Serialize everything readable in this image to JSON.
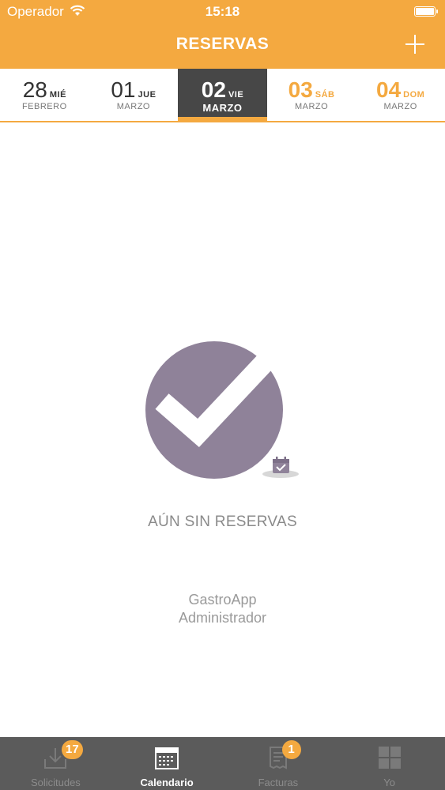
{
  "status_bar": {
    "carrier": "Operador",
    "time": "15:18"
  },
  "nav": {
    "title": "RESERVAS",
    "add_icon": "plus-icon"
  },
  "dates": [
    {
      "day": "28",
      "dow": "MIÉ",
      "month": "FEBRERO",
      "selected": false,
      "weekend": false
    },
    {
      "day": "01",
      "dow": "JUE",
      "month": "MARZO",
      "selected": false,
      "weekend": false
    },
    {
      "day": "02",
      "dow": "VIE",
      "month": "MARZO",
      "selected": true,
      "weekend": false
    },
    {
      "day": "03",
      "dow": "SÁB",
      "month": "MARZO",
      "selected": false,
      "weekend": true
    },
    {
      "day": "04",
      "dow": "DOM",
      "month": "MARZO",
      "selected": false,
      "weekend": true
    }
  ],
  "empty_state": {
    "icon": "checkmark-circle-icon",
    "message": "AÚN SIN RESERVAS",
    "app_name": "GastroApp",
    "app_role": "Administrador"
  },
  "tabs": [
    {
      "label": "Solicitudes",
      "icon": "inbox-download-icon",
      "badge": "17",
      "active": false
    },
    {
      "label": "Calendario",
      "icon": "calendar-icon",
      "badge": "",
      "active": true
    },
    {
      "label": "Facturas",
      "icon": "invoice-icon",
      "badge": "1",
      "active": false
    },
    {
      "label": "Yo",
      "icon": "grid-icon",
      "badge": "",
      "active": false
    }
  ],
  "colors": {
    "accent": "#f4a940",
    "selected_day_bg": "#474747",
    "tabbar_bg": "#5b5b5b",
    "check_circle": "#8f8299"
  }
}
